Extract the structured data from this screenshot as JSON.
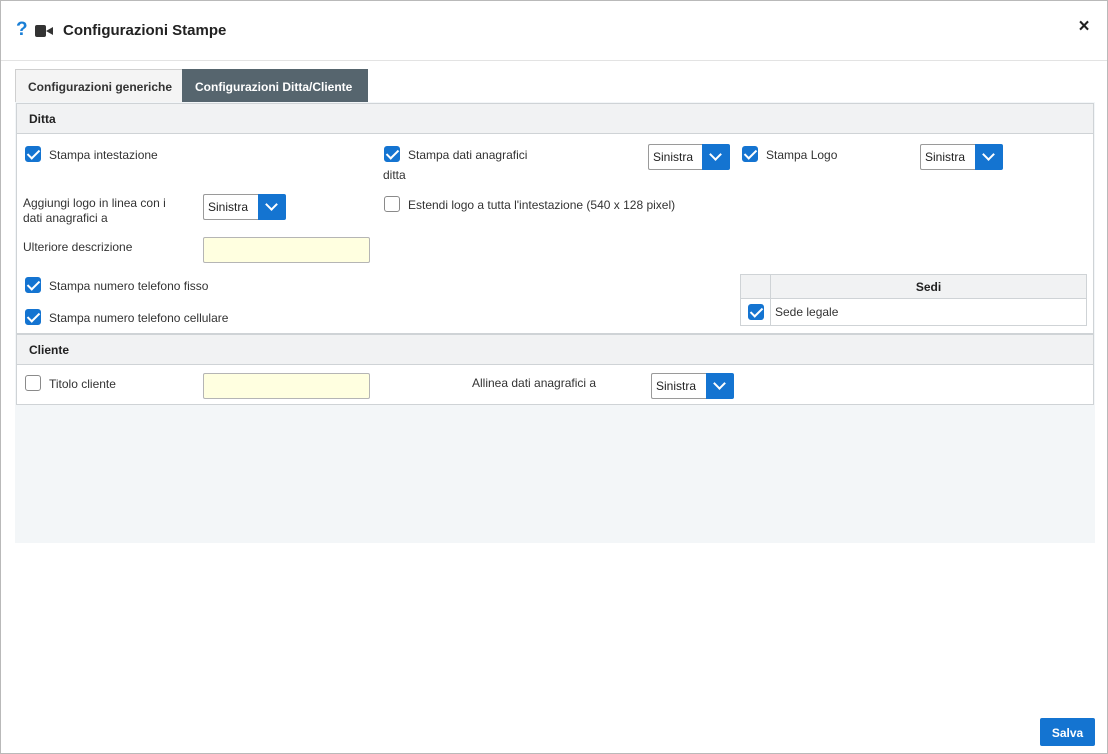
{
  "dialog": {
    "title": "Configurazioni Stampe",
    "help_icon": "?",
    "close_icon": "×"
  },
  "tabs": [
    {
      "label": "Configurazioni generiche",
      "active": false
    },
    {
      "label": "Configurazioni Ditta/Cliente",
      "active": true
    }
  ],
  "ditta": {
    "title": "Ditta",
    "stampa_intestazione": {
      "label": "Stampa intestazione",
      "checked": true
    },
    "stampa_dati_anagrafici": {
      "label_line1": "Stampa dati anagrafici",
      "label_line2": "ditta",
      "checked": true,
      "select_value": "Sinistra"
    },
    "stampa_logo": {
      "label": "Stampa Logo",
      "checked": true,
      "select_value": "Sinistra"
    },
    "aggiungi_logo": {
      "label_line1": "Aggiungi logo in linea con i",
      "label_line2": "dati anagrafici a",
      "select_value": "Sinistra"
    },
    "estendi_logo": {
      "label": "Estendi logo a tutta l'intestazione (540 x 128 pixel)",
      "checked": false
    },
    "ulteriore_descrizione": {
      "label": "Ulteriore descrizione",
      "value": ""
    },
    "telefono_fisso": {
      "label": "Stampa numero telefono fisso",
      "checked": true
    },
    "telefono_cellulare": {
      "label": "Stampa numero telefono cellulare",
      "checked": true
    },
    "sedi": {
      "header": "Sedi",
      "rows": [
        {
          "label": "Sede legale",
          "checked": true
        }
      ]
    }
  },
  "cliente": {
    "title": "Cliente",
    "titolo_cliente": {
      "label": "Titolo cliente",
      "checked": false,
      "value": ""
    },
    "allinea": {
      "label": "Allinea dati anagrafici a",
      "select_value": "Sinistra"
    }
  },
  "footer": {
    "save_label": "Salva"
  },
  "colors": {
    "accent": "#1474d1",
    "active_tab": "#56656e",
    "input_bg": "#ffffe0"
  }
}
